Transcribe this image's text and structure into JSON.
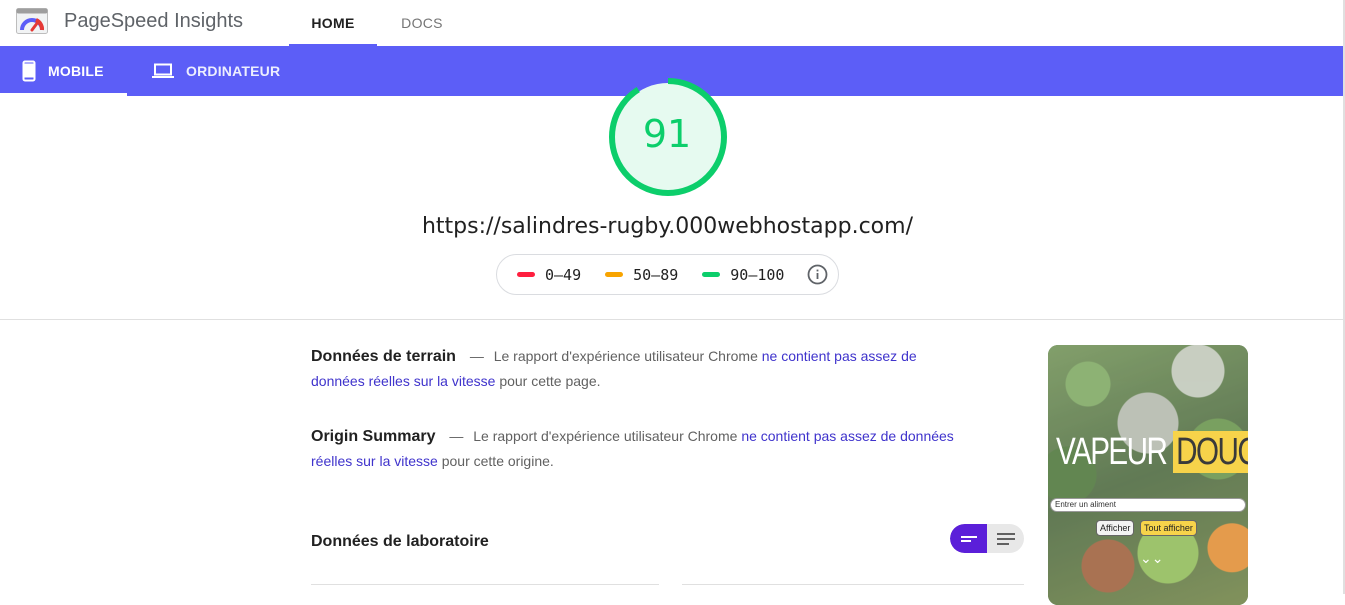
{
  "app": {
    "title": "PageSpeed Insights"
  },
  "nav": {
    "tabs": [
      {
        "label": "HOME"
      },
      {
        "label": "DOCS"
      }
    ]
  },
  "device_tabs": [
    {
      "label": "MOBILE"
    },
    {
      "label": "ORDINATEUR"
    }
  ],
  "score": {
    "value": "91",
    "level": 0.91,
    "color": "#0cce6b"
  },
  "url": "https://salindres-rugby.000webhostapp.com/",
  "legend": [
    {
      "range": "0–49",
      "color": "#ff1f3f"
    },
    {
      "range": "50–89",
      "color": "#f8a400"
    },
    {
      "range": "90–100",
      "color": "#0cce6b"
    }
  ],
  "field_data": {
    "title": "Données de terrain",
    "dash": "—",
    "text_before": "Le rapport d'expérience utilisateur Chrome",
    "link": "ne contient pas assez de données réelles sur la vitesse",
    "text_after": "pour cette page."
  },
  "origin_summary": {
    "title": "Origin Summary",
    "dash": "—",
    "text_before": "Le rapport d'expérience utilisateur Chrome",
    "link": "ne contient pas assez de données réelles sur la vitesse",
    "text_after": "pour cette origine."
  },
  "lab_data": {
    "title": "Données de laboratoire"
  },
  "thumbnail": {
    "brand_a": "VAPEUR",
    "brand_b": "DOUCE",
    "input_placeholder": "Entrer un aliment",
    "button_show": "Afficher",
    "button_show_all": "Tout afficher",
    "chevron": "⌄⌄"
  },
  "colors": {
    "accent": "#5c5ef7",
    "link": "#3f33cc",
    "toggle_active": "#5b1fd9"
  }
}
